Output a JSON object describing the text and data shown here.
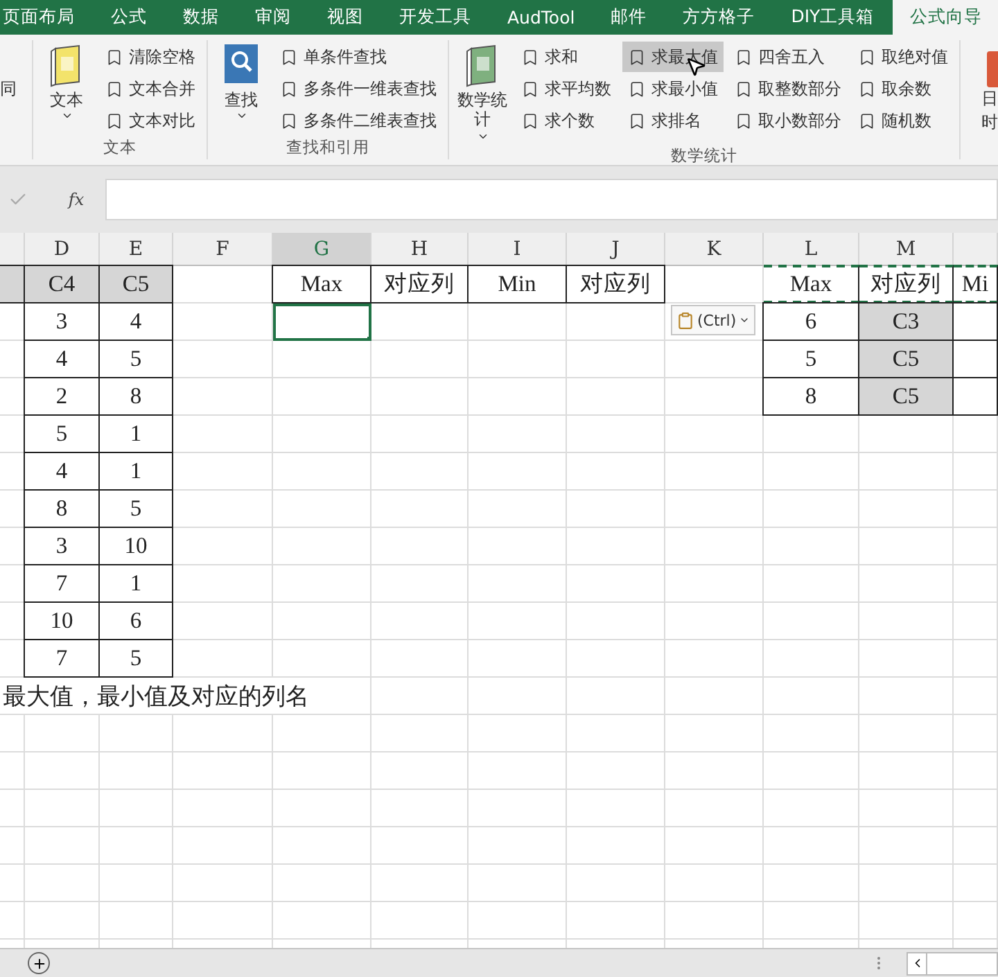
{
  "ribbon_tabs": [
    {
      "label": "页面布局",
      "selected": false
    },
    {
      "label": "公式",
      "selected": false
    },
    {
      "label": "数据",
      "selected": false
    },
    {
      "label": "审阅",
      "selected": false
    },
    {
      "label": "视图",
      "selected": false
    },
    {
      "label": "开发工具",
      "selected": false
    },
    {
      "label": "AudTool",
      "selected": false
    },
    {
      "label": "邮件",
      "selected": false
    },
    {
      "label": "方方格子",
      "selected": false
    },
    {
      "label": "DIY工具箱",
      "selected": false
    },
    {
      "label": "公式向导",
      "selected": true
    }
  ],
  "ribbon": {
    "left_edge_text": "同",
    "groups": [
      {
        "label": "文本",
        "big_button": {
          "label": "文本",
          "kind": "text"
        },
        "columns": [
          [
            {
              "label": "清除空格",
              "hovered": false
            },
            {
              "label": "文本合并",
              "hovered": false
            },
            {
              "label": "文本对比",
              "hovered": false
            }
          ]
        ]
      },
      {
        "label": "查找和引用",
        "big_button": {
          "label": "查找",
          "kind": "lookup"
        },
        "columns": [
          [
            {
              "label": "单条件查找",
              "hovered": false
            },
            {
              "label": "多条件一维表查找",
              "hovered": false
            },
            {
              "label": "多条件二维表查找",
              "hovered": false
            }
          ]
        ]
      },
      {
        "label": "数学统计",
        "big_button": {
          "label": "数学统计",
          "kind": "math"
        },
        "columns": [
          [
            {
              "label": "求和",
              "hovered": false
            },
            {
              "label": "求平均数",
              "hovered": false
            },
            {
              "label": "求个数",
              "hovered": false
            }
          ],
          [
            {
              "label": "求最大值",
              "hovered": true
            },
            {
              "label": "求最小值",
              "hovered": false
            },
            {
              "label": "求排名",
              "hovered": false
            }
          ],
          [
            {
              "label": "四舍五入",
              "hovered": false
            },
            {
              "label": "取整数部分",
              "hovered": false
            },
            {
              "label": "取小数部分",
              "hovered": false
            }
          ],
          [
            {
              "label": "取绝对值",
              "hovered": false
            },
            {
              "label": "取余数",
              "hovered": false
            },
            {
              "label": "随机数",
              "hovered": false
            }
          ]
        ]
      }
    ],
    "right_edge_lines": [
      "日",
      "时"
    ]
  },
  "formula_bar": {
    "fx": "fx"
  },
  "sheet": {
    "columns": [
      {
        "selected": false
      },
      {
        "label": "D",
        "selected": false
      },
      {
        "label": "E",
        "selected": false
      },
      {
        "label": "F",
        "selected": false
      },
      {
        "label": "G",
        "selected": true
      },
      {
        "label": "H",
        "selected": false
      },
      {
        "label": "I",
        "selected": false
      },
      {
        "label": "J",
        "selected": false
      },
      {
        "label": "K",
        "selected": false
      },
      {
        "label": "L",
        "selected": false
      },
      {
        "label": "M",
        "selected": false
      },
      {
        "selected": false
      }
    ],
    "rows": [
      {
        "cells": [
          {
            "kind": "boxed",
            "shaded": true
          },
          {
            "text": "C4",
            "kind": "boxed",
            "shaded": true
          },
          {
            "text": "C5",
            "kind": "boxed",
            "shaded": true
          },
          {},
          {
            "text": "Max",
            "kind": "boxed"
          },
          {
            "text": "对应列",
            "kind": "boxed"
          },
          {
            "text": "Min",
            "kind": "boxed"
          },
          {
            "text": "对应列",
            "kind": "boxed"
          },
          {},
          {
            "text": "Max",
            "kind": "marquee"
          },
          {
            "text": "对应列",
            "kind": "marquee"
          },
          {
            "text": "Mi",
            "kind": "marquee"
          }
        ]
      },
      {
        "cells": [
          {},
          {
            "text": "3",
            "kind": "boxed"
          },
          {
            "text": "4",
            "kind": "boxed"
          },
          {},
          {
            "selected": true
          },
          {},
          {},
          {},
          {},
          {
            "text": "6",
            "kind": "boxed"
          },
          {
            "text": "C3",
            "kind": "boxed",
            "shaded": true
          },
          {
            "kind": "boxed"
          }
        ]
      },
      {
        "cells": [
          {},
          {
            "text": "4",
            "kind": "boxed"
          },
          {
            "text": "5",
            "kind": "boxed"
          },
          {},
          {},
          {},
          {},
          {},
          {},
          {
            "text": "5",
            "kind": "boxed"
          },
          {
            "text": "C5",
            "kind": "boxed",
            "shaded": true
          },
          {
            "kind": "boxed"
          }
        ]
      },
      {
        "cells": [
          {},
          {
            "text": "2",
            "kind": "boxed"
          },
          {
            "text": "8",
            "kind": "boxed"
          },
          {},
          {},
          {},
          {},
          {},
          {},
          {
            "text": "8",
            "kind": "boxed"
          },
          {
            "text": "C5",
            "kind": "boxed",
            "shaded": true
          },
          {
            "kind": "boxed"
          }
        ]
      },
      {
        "cells": [
          {},
          {
            "text": "5",
            "kind": "boxed"
          },
          {
            "text": "1",
            "kind": "boxed"
          }
        ]
      },
      {
        "cells": [
          {},
          {
            "text": "4",
            "kind": "boxed"
          },
          {
            "text": "1",
            "kind": "boxed"
          }
        ]
      },
      {
        "cells": [
          {},
          {
            "text": "8",
            "kind": "boxed"
          },
          {
            "text": "5",
            "kind": "boxed"
          }
        ]
      },
      {
        "cells": [
          {},
          {
            "text": "3",
            "kind": "boxed"
          },
          {
            "text": "10",
            "kind": "boxed"
          }
        ]
      },
      {
        "cells": [
          {},
          {
            "text": "7",
            "kind": "boxed"
          },
          {
            "text": "1",
            "kind": "boxed"
          }
        ]
      },
      {
        "cells": [
          {},
          {
            "text": "10",
            "kind": "boxed"
          },
          {
            "text": "6",
            "kind": "boxed"
          }
        ]
      },
      {
        "cells": [
          {},
          {
            "text": "7",
            "kind": "boxed"
          },
          {
            "text": "5",
            "kind": "boxed"
          }
        ]
      },
      {
        "cells": [
          {
            "text": "最大值，最小值及对应的列名",
            "kind": "overflow"
          }
        ]
      }
    ],
    "paste_options": {
      "label": "(Ctrl)"
    }
  }
}
